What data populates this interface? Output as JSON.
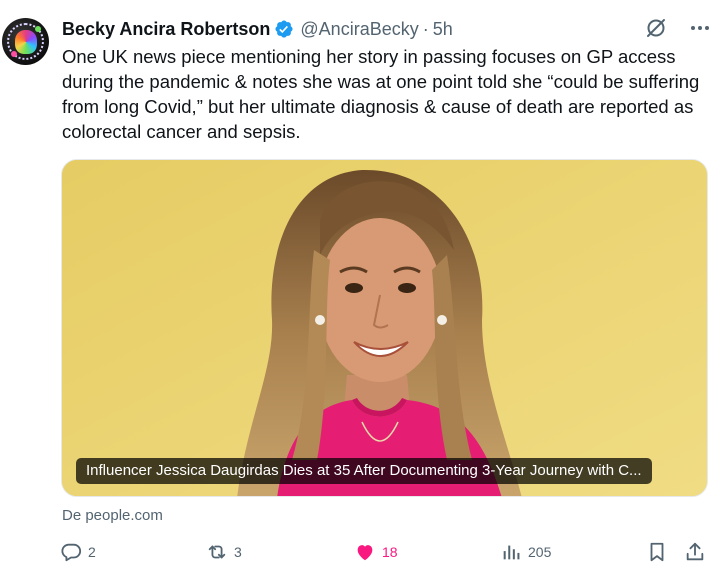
{
  "author": {
    "name": "Becky Ancira Robertson",
    "handle": "@AnciraBecky",
    "separator": "·",
    "time": "5h",
    "verified": true,
    "verified_color": "#1d9bf0"
  },
  "tweet": {
    "text": "One UK news piece mentioning her story in passing focuses on GP access during the pandemic & notes she was at one point told she “could be suffering from long Covid,” but her ultimate diagnosis & cause of death are reported as colorectal cancer and sepsis."
  },
  "card": {
    "caption": "Influencer Jessica Daugirdas Dies at 35 After Documenting 3-Year Journey with C...",
    "source": "De people.com",
    "image_description_icon": "photo-of-smiling-woman"
  },
  "actions": {
    "replies": "2",
    "reposts": "3",
    "likes": "18",
    "views": "205"
  },
  "icons": {
    "grok": "grok-icon",
    "more": "more-icon",
    "reply": "reply-icon",
    "repost": "repost-icon",
    "like": "heart-icon",
    "views": "views-icon",
    "bookmark": "bookmark-icon",
    "share": "share-icon"
  },
  "colors": {
    "text": "#0f1419",
    "secondary": "#536471",
    "like": "#f91880",
    "verified": "#1d9bf0"
  }
}
